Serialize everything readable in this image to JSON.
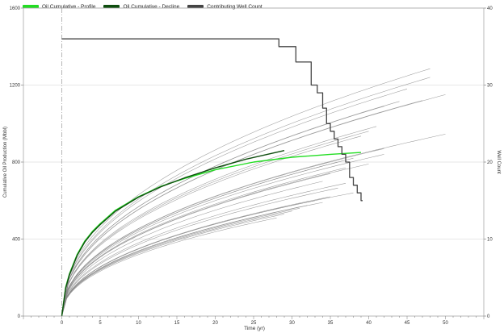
{
  "legend": {
    "items": [
      {
        "label": "Oil Cumulative - Profile",
        "color": "#22dd22"
      },
      {
        "label": "Oil Cumulative - Decline",
        "color": "#0e4d0e"
      },
      {
        "label": "Contributing Well Count",
        "color": "#444444"
      }
    ]
  },
  "chart_data": {
    "type": "line",
    "title": "",
    "xlabel": "Time (yr)",
    "ylabel": "Cumulative Oil Production (Mbbl)",
    "y2label": "Well Count",
    "xlim": [
      -5,
      55
    ],
    "ylim": [
      0,
      1600
    ],
    "y2lim": [
      0,
      40
    ],
    "x_ticks": [
      0,
      5,
      10,
      15,
      20,
      25,
      30,
      35,
      40,
      45,
      50
    ],
    "y_ticks": [
      0,
      400,
      800,
      1200,
      1600
    ],
    "y2_ticks": [
      0,
      10,
      20,
      30,
      40
    ],
    "grid": true,
    "vertical_reference_line_x": 0,
    "legend_position": "top-left",
    "series": [
      {
        "name": "Oil Cumulative - Profile",
        "color": "#22dd22",
        "x": [
          0,
          0.5,
          1,
          2,
          3,
          4,
          5,
          7,
          10,
          13,
          16,
          20,
          25,
          30,
          35,
          39
        ],
        "y": [
          0,
          150,
          220,
          320,
          390,
          440,
          480,
          550,
          620,
          675,
          715,
          760,
          800,
          825,
          840,
          850
        ]
      },
      {
        "name": "Oil Cumulative - Decline",
        "color": "#0e4d0e",
        "x": [
          0,
          0.5,
          1,
          2,
          3,
          4,
          5,
          7,
          10,
          13,
          16,
          20,
          24,
          29
        ],
        "y": [
          0,
          145,
          215,
          315,
          385,
          435,
          475,
          545,
          618,
          673,
          718,
          770,
          815,
          860
        ]
      },
      {
        "name": "Contributing Well Count",
        "color": "#444444",
        "axis": "right",
        "x": [
          0,
          28.3,
          28.3,
          30.5,
          30.5,
          32.5,
          32.5,
          33.3,
          33.3,
          34,
          34,
          34.5,
          34.5,
          35,
          35,
          35.5,
          35.5,
          36,
          36,
          36.5,
          36.5,
          37,
          37,
          37.5,
          37.5,
          38,
          38,
          38.5,
          38.5,
          39,
          39,
          39.2
        ],
        "y": [
          36,
          36,
          35,
          35,
          33,
          33,
          30,
          30,
          29,
          29,
          27,
          27,
          25,
          25,
          24,
          24,
          23,
          23,
          22,
          22,
          21,
          21,
          20,
          20,
          18,
          18,
          17,
          17,
          16,
          16,
          15,
          15
        ]
      }
    ],
    "well_curves": {
      "color": "#8a8a8a",
      "count": 30,
      "curves": [
        {
          "end_x": 48,
          "end_y": 1285
        },
        {
          "end_x": 48,
          "end_y": 1240
        },
        {
          "end_x": 45,
          "end_y": 1180
        },
        {
          "end_x": 50,
          "end_y": 1150
        },
        {
          "end_x": 47,
          "end_y": 1120
        },
        {
          "end_x": 44,
          "end_y": 1115
        },
        {
          "end_x": 42,
          "end_y": 1090
        },
        {
          "end_x": 50,
          "end_y": 945
        },
        {
          "end_x": 41,
          "end_y": 985
        },
        {
          "end_x": 40,
          "end_y": 960
        },
        {
          "end_x": 39,
          "end_y": 935
        },
        {
          "end_x": 42,
          "end_y": 870
        },
        {
          "end_x": 42,
          "end_y": 840
        },
        {
          "end_x": 38,
          "end_y": 820
        },
        {
          "end_x": 36,
          "end_y": 800
        },
        {
          "end_x": 40,
          "end_y": 790
        },
        {
          "end_x": 37,
          "end_y": 770
        },
        {
          "end_x": 35,
          "end_y": 740
        },
        {
          "end_x": 34,
          "end_y": 700
        },
        {
          "end_x": 37,
          "end_y": 690
        },
        {
          "end_x": 38,
          "end_y": 640
        },
        {
          "end_x": 36,
          "end_y": 665
        },
        {
          "end_x": 35,
          "end_y": 620
        },
        {
          "end_x": 33,
          "end_y": 600
        },
        {
          "end_x": 34,
          "end_y": 590
        },
        {
          "end_x": 32,
          "end_y": 575
        },
        {
          "end_x": 31,
          "end_y": 560
        },
        {
          "end_x": 30,
          "end_y": 545
        },
        {
          "end_x": 29,
          "end_y": 530
        },
        {
          "end_x": 28,
          "end_y": 510
        }
      ]
    }
  }
}
